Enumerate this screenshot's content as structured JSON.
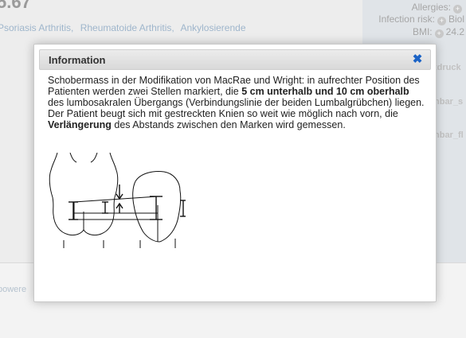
{
  "background": {
    "title_fragment": "5.67",
    "diagnoses": [
      "Psoriasis Arthritis,",
      "Rheumatoide Arthritis,",
      "Ankylosierende"
    ],
    "allergies_label": "Allergies:",
    "infection_risk_label": "Infection risk:",
    "infection_risk_value": "Biol",
    "bmi_label": "BMI:",
    "bmi_value": "24.2",
    "side_items": [
      "tdruck",
      "nbar_s",
      "nbar_fl"
    ],
    "footer_text": "powere"
  },
  "modal": {
    "title": "Information",
    "close_symbol": "✖",
    "text": {
      "part1": "Schobermass in der Modifikation von MacRae und Wright: in aufrechter Position des Patienten werden zwei Stellen markiert, die ",
      "bold1": "5 cm unterhalb und 10 cm oberhalb",
      "part2": " des lumbosakralen Übergangs (Verbindungslinie der beiden Lumbalgrübchen) liegen. Der Patient beugt sich mit gestreckten Knien so weit wie möglich nach vorn, die ",
      "bold2": "Verlängerung",
      "part3": " des Abstands zwischen den Marken wird gemessen."
    },
    "figure_icon": "schober-test-illustration"
  },
  "colors": {
    "link": "#1b63c6",
    "overlay_text": "#a6a6a6",
    "diagnosis_link": "#9fb6cc"
  }
}
